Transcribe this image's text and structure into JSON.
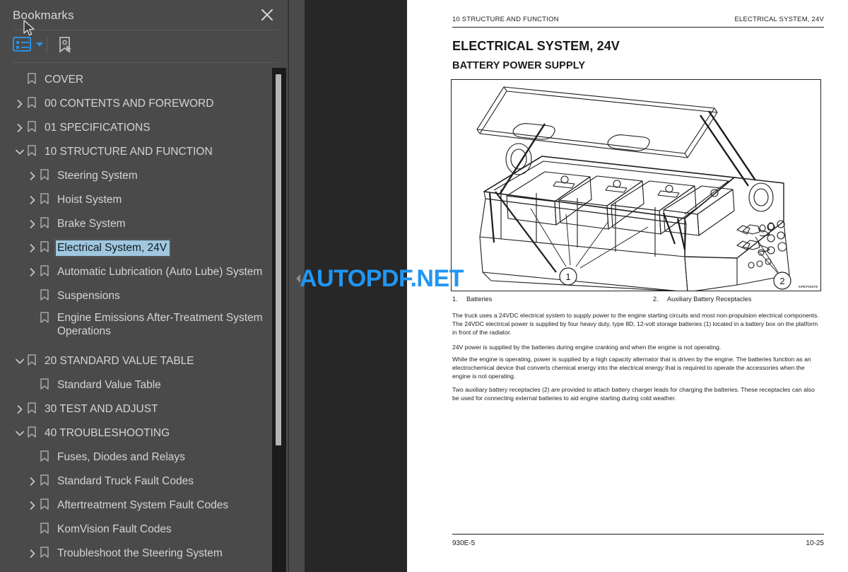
{
  "sidebar": {
    "title": "Bookmarks",
    "close_icon": "close-icon",
    "toolbar": {
      "options_icon": "bookmark-options-list-icon",
      "options_caret": "chevron-down-icon",
      "new_bookmark_icon": "new-bookmark-pointer-icon"
    },
    "items": [
      {
        "label": "COVER",
        "level": 0,
        "arrow": "none",
        "selected": false
      },
      {
        "label": "00 CONTENTS AND FOREWORD",
        "level": 0,
        "arrow": "collapsed",
        "selected": false
      },
      {
        "label": "01 SPECIFICATIONS",
        "level": 0,
        "arrow": "collapsed",
        "selected": false
      },
      {
        "label": "10 STRUCTURE AND FUNCTION",
        "level": 0,
        "arrow": "expanded",
        "selected": false
      },
      {
        "label": "Steering System",
        "level": 1,
        "arrow": "collapsed",
        "selected": false
      },
      {
        "label": "Hoist System",
        "level": 1,
        "arrow": "collapsed",
        "selected": false
      },
      {
        "label": "Brake System",
        "level": 1,
        "arrow": "collapsed",
        "selected": false
      },
      {
        "label": "Electrical System, 24V",
        "level": 1,
        "arrow": "collapsed",
        "selected": true
      },
      {
        "label": "Automatic Lubrication (Auto Lube) System",
        "level": 1,
        "arrow": "collapsed",
        "selected": false
      },
      {
        "label": "Suspensions",
        "level": 1,
        "arrow": "none",
        "selected": false
      },
      {
        "label": "Engine Emissions After-Treatment System Operations",
        "level": 1,
        "arrow": "none",
        "selected": false,
        "two_line": true
      },
      {
        "label": "20 STANDARD VALUE TABLE",
        "level": 0,
        "arrow": "expanded",
        "selected": false
      },
      {
        "label": "Standard Value Table",
        "level": 1,
        "arrow": "none",
        "selected": false
      },
      {
        "label": "30 TEST AND ADJUST",
        "level": 0,
        "arrow": "collapsed",
        "selected": false
      },
      {
        "label": "40 TROUBLESHOOTING",
        "level": 0,
        "arrow": "expanded",
        "selected": false
      },
      {
        "label": "Fuses, Diodes and Relays",
        "level": 1,
        "arrow": "none",
        "selected": false
      },
      {
        "label": "Standard Truck Fault Codes",
        "level": 1,
        "arrow": "collapsed",
        "selected": false
      },
      {
        "label": "Aftertreatment System Fault Codes",
        "level": 1,
        "arrow": "collapsed",
        "selected": false
      },
      {
        "label": "KomVision Fault Codes",
        "level": 1,
        "arrow": "none",
        "selected": false
      },
      {
        "label": "Troubleshoot the Steering System",
        "level": 1,
        "arrow": "collapsed",
        "selected": false
      }
    ]
  },
  "viewer": {
    "collapse_handle_icon": "collapse-left-arrow-icon",
    "watermark": "AUTOPDF.NET",
    "watermark_color": "#2196f3"
  },
  "page": {
    "header_left": "10 STRUCTURE AND FUNCTION",
    "header_right": "ELECTRICAL SYSTEM, 24V",
    "title": "ELECTRICAL SYSTEM, 24V",
    "subtitle": "BATTERY POWER SUPPLY",
    "figure": {
      "alt": "battery-box-line-drawing",
      "code": "KPET00478",
      "callouts": [
        "1",
        "2"
      ]
    },
    "legend": [
      {
        "num": "1.",
        "text": "Batteries"
      },
      {
        "num": "2.",
        "text": "Auxiliary Battery Receptacles"
      }
    ],
    "paragraphs": [
      "The truck uses a 24VDC electrical system to supply power to the engine starting circuits and most non-propulsion electrical components. The 24VDC electrical power is supplied by four heavy duty, type 8D, 12-volt storage batteries (1) located in a battery box on the platform in front of the radiator.",
      "24V power is supplied by the batteries during engine cranking and when the engine is not operating.",
      "While the engine is operating, power is supplied by a high capacity alternator that is driven by the engine. The batteries function as an electrochemical device that converts chemical energy into the electrical energy that is required to operate the accessories when the engine is not operating.",
      "Two auxiliary battery receptacles (2) are provided to attach battery charger leads for charging the batteries. These receptacles can also be used for connecting external batteries to aid engine starting during cold weather."
    ],
    "footer_left": "930E-5",
    "footer_right": "10-25"
  }
}
